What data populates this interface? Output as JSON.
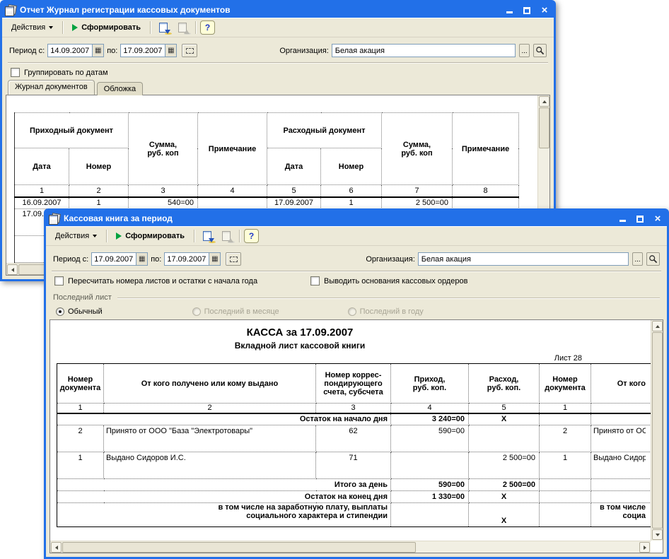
{
  "colors": {
    "titlebar_blue": "#2270E8",
    "window_beige": "#ECE9D8",
    "generate_green": "#00A23F",
    "input_border": "#7F9DB9"
  },
  "icons": {
    "close": "×",
    "calendar": "▦",
    "more": "...",
    "help": "?"
  },
  "back": {
    "title": "Отчет Журнал регистрации кассовых документов",
    "toolbar": {
      "actions": "Действия",
      "generate": "Сформировать"
    },
    "period": {
      "from_label": "Период с:",
      "from": "14.09.2007",
      "to_label": "по:",
      "to": "17.09.2007"
    },
    "org": {
      "label": "Организация:",
      "value": "Белая акация"
    },
    "group_checkbox": "Группировать по датам",
    "tabs": [
      "Журнал документов",
      "Обложка"
    ],
    "table": {
      "h_prihod": "Приходный документ",
      "h_rashod": "Расходный документ",
      "h_summa": "Сумма,\nруб. коп",
      "h_note": "Примечание",
      "h_date": "Дата",
      "h_num": "Номер",
      "nums": [
        "1",
        "2",
        "3",
        "4",
        "5",
        "6",
        "7",
        "8"
      ],
      "rows": [
        [
          "16.09.2007",
          "1",
          "540=00",
          "",
          "17.09.2007",
          "1",
          "2 500=00",
          ""
        ],
        [
          "17.09.2007",
          "",
          "",
          "",
          "",
          "",
          "",
          ""
        ]
      ]
    }
  },
  "front": {
    "title": "Кассовая книга за период",
    "toolbar": {
      "actions": "Действия",
      "generate": "Сформировать"
    },
    "period": {
      "from_label": "Период с:",
      "from": "17.09.2007",
      "to_label": "по:",
      "to": "17.09.2007"
    },
    "org": {
      "label": "Организация:",
      "value": "Белая акация"
    },
    "checkbox1": "Пересчитать номера листов и остатки с начала года",
    "checkbox2": "Выводить основания кассовых ордеров",
    "group_label": "Последний лист",
    "radios": [
      "Обычный",
      "Последний в месяце",
      "Последний в году"
    ],
    "report": {
      "title": "КАССА за 17.09.2007",
      "subtitle": "Вкладной лист кассовой книги",
      "sheet_label": "Лист 28",
      "headers": {
        "doc_num": "Номер\nдокумента",
        "who": "От кого получено или кому выдано",
        "korr": "Номер коррес-\nпондирующего\nсчета, субсчета",
        "prihod": "Приход,\nруб. коп.",
        "rashod": "Расход,\nруб. коп.",
        "doc_num2": "Номер\nдокумента",
        "who2": "От кого"
      },
      "nums": [
        "1",
        "2",
        "3",
        "4",
        "5",
        "1"
      ],
      "opening": {
        "label": "Остаток на начало дня",
        "prihod": "3 240=00",
        "rashod": "Х"
      },
      "entries": [
        {
          "num": "2",
          "who": "Принято от ООО \"База \"Электротовары\"",
          "korr": "62",
          "prihod": "590=00",
          "rashod": "",
          "num2": "2",
          "who2": "Принято от ООО \"База \"Электротовары\""
        },
        {
          "num": "1",
          "who": "Выдано Сидоров И.С.",
          "korr": "71",
          "prihod": "",
          "rashod": "2 500=00",
          "num2": "1",
          "who2": "Выдано Сидоров И.С."
        }
      ],
      "total": {
        "label": "Итого за день",
        "prihod": "590=00",
        "rashod": "2 500=00"
      },
      "closing": {
        "label": "Остаток на конец дня",
        "prihod": "1 330=00",
        "rashod": "Х"
      },
      "including": {
        "label": "в том числе на заработную плату, выплаты\nсоциального характера и стипендии",
        "rashod": "Х",
        "right": "в том числе\nсоциа"
      }
    }
  }
}
